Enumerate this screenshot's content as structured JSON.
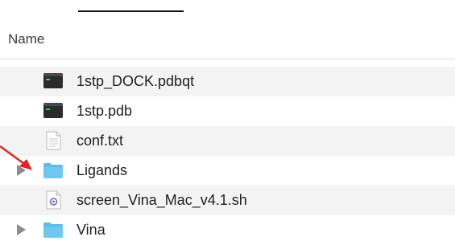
{
  "header": {
    "column_name": "Name"
  },
  "files": [
    {
      "name": "1stp_DOCK.pdbqt",
      "icon": "terminal-file-icon",
      "expandable": false
    },
    {
      "name": "1stp.pdb",
      "icon": "terminal-file-icon",
      "expandable": false
    },
    {
      "name": "conf.txt",
      "icon": "text-document-icon",
      "expandable": false
    },
    {
      "name": "Ligands",
      "icon": "folder-icon",
      "expandable": true
    },
    {
      "name": "screen_Vina_Mac_v4.1.sh",
      "icon": "script-file-icon",
      "expandable": false
    },
    {
      "name": "Vina",
      "icon": "folder-icon",
      "expandable": true
    }
  ],
  "colors": {
    "folder": "#5cbbe8",
    "arrow": "#e02424",
    "alternate_row": "#f3f3f3"
  }
}
